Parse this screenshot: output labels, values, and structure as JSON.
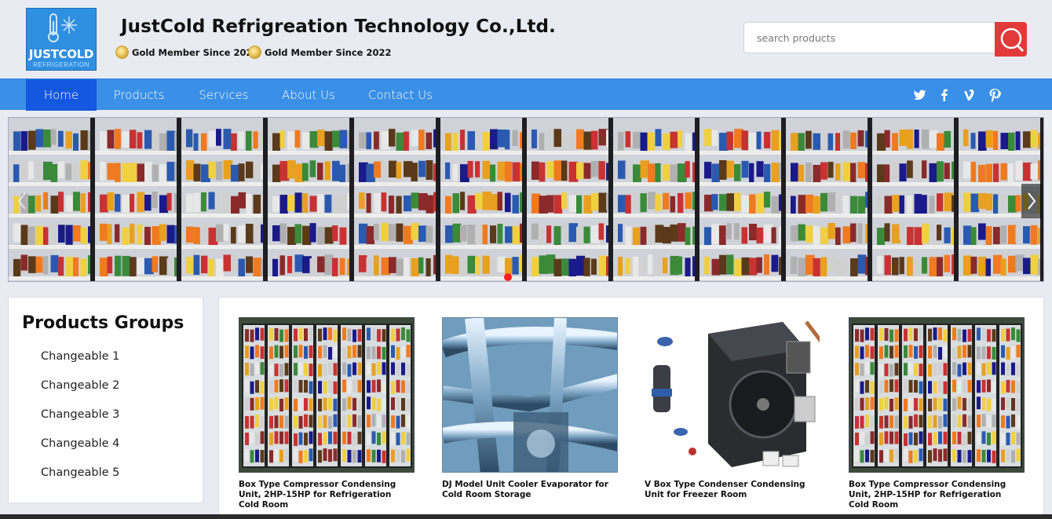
{
  "header": {
    "logo_text": "JUSTCOLD",
    "logo_subtext": "REFRIGERATION",
    "company_name": "JustCold Refrigreation Technology Co.,Ltd.",
    "badges": [
      "Gold Member Since 2022",
      "Gold Member Since 2022"
    ],
    "search_placeholder": "search products"
  },
  "nav": {
    "items": [
      "Home",
      "Products",
      "Services",
      "About Us",
      "Contact Us"
    ],
    "active": "Home",
    "social_icons": [
      "twitter-icon",
      "facebook-icon",
      "vimeo-icon",
      "pinterest-icon"
    ]
  },
  "sidebar": {
    "title": "Products Groups",
    "items": [
      "Changeable 1",
      "Changeable 2",
      "Changeable 3",
      "Changeable 4",
      "Changeable 5"
    ]
  },
  "products": [
    {
      "title": "Box Type Compressor Condensing Unit, 2HP-15HP for Refrigeration Cold Room"
    },
    {
      "title": "DJ Model Unit Cooler Evaporator for Cold Room Storage"
    },
    {
      "title": "V Box Type Condenser Condensing Unit for Freezer Room"
    },
    {
      "title": "Box Type Compressor Condensing Unit, 2HP-15HP for Refrigeration Cold Room"
    }
  ],
  "colors": {
    "nav_bg": "#3a8fe6",
    "nav_active": "#1558e0",
    "search_button": "#e23a3a",
    "logo_bg": "#2f8fe0",
    "slider_dot_active": "#ff1e1e"
  }
}
